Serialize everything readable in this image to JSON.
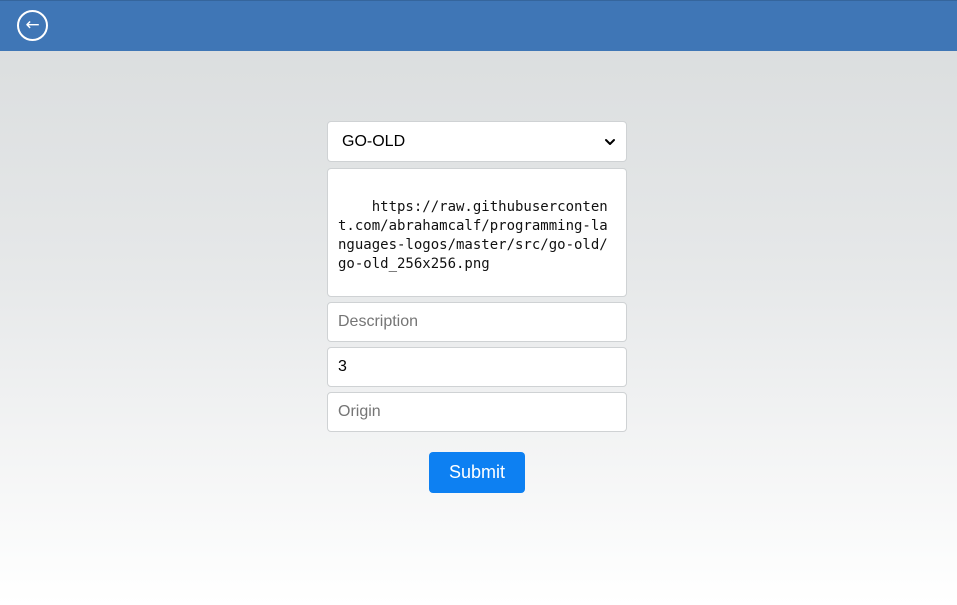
{
  "header": {
    "back_icon": "←"
  },
  "form": {
    "language_select": {
      "selected": "GO-OLD"
    },
    "image_url": {
      "value": "https://raw.githubusercontent.com/abrahamcalf/programming-languages-logos/master/src/go-old/go-old_256x256.png"
    },
    "description": {
      "value": "",
      "placeholder": "Description"
    },
    "number": {
      "value": "3"
    },
    "origin": {
      "value": "",
      "placeholder": "Origin"
    },
    "submit_label": "Submit"
  },
  "colors": {
    "header_bg": "#3f76b6",
    "submit_bg": "#0d80f2"
  }
}
